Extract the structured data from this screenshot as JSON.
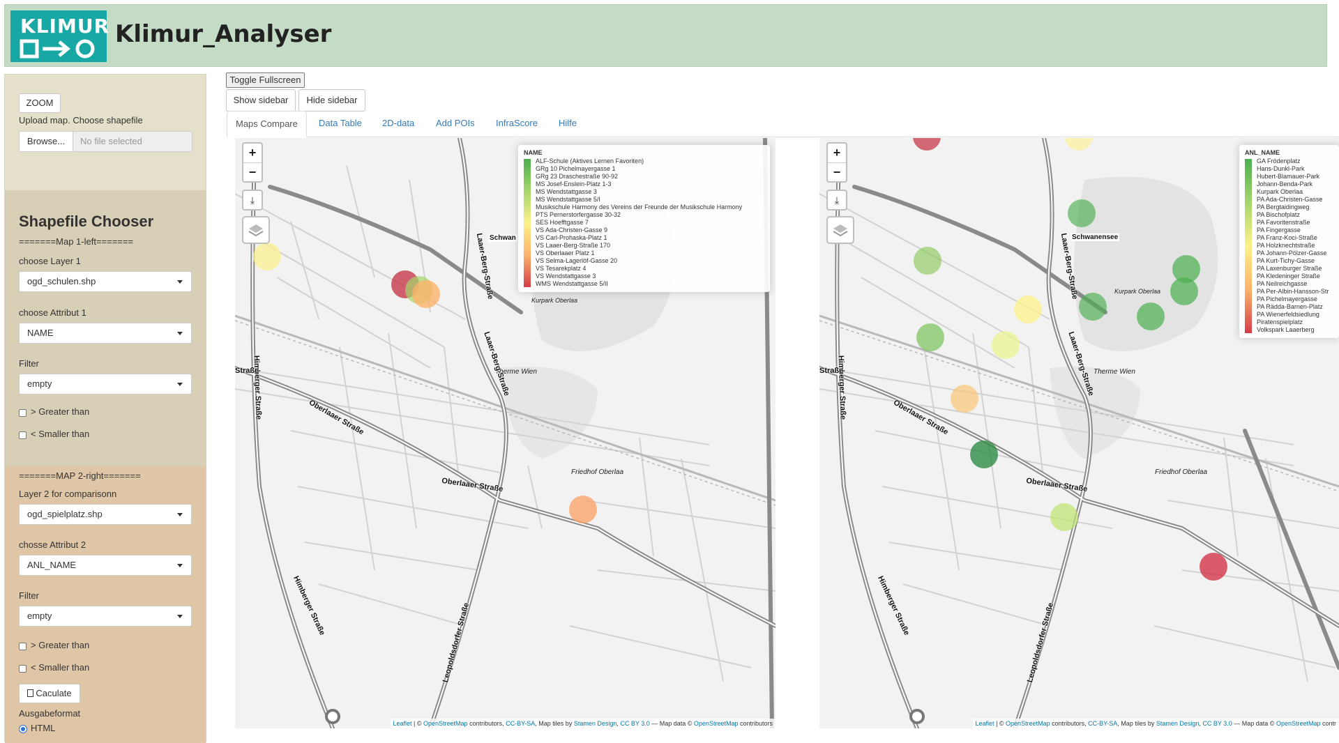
{
  "header": {
    "logo_text": "KLIMUR",
    "title": "Klimur_Analyser"
  },
  "sidebar": {
    "zoom_label": "ZOOM",
    "upload_label": "Upload map. Choose shapefile",
    "browse_label": "Browse...",
    "file_placeholder": "No file selected",
    "chooser_title": "Shapefile Chooser",
    "map1_heading": "=======Map 1-left=======",
    "layer1_label": "choose Layer 1",
    "layer1_value": "ogd_schulen.shp",
    "attr1_label": "choose Attribut 1",
    "attr1_value": "NAME",
    "filter1_label": "Filter",
    "filter1_value": "empty",
    "greater1_label": "> Greater than",
    "smaller1_label": "< Smaller than",
    "map2_heading": "=======MAP 2-right=======",
    "layer2_label": "Layer 2 for comparisonn",
    "layer2_value": "ogd_spielplatz.shp",
    "attr2_label": "chosse Attribut 2",
    "attr2_value": "ANL_NAME",
    "filter2_label": "Filter",
    "filter2_value": "empty",
    "greater2_label": "> Greater than",
    "smaller2_label": "< Smaller than",
    "calculate_label": "Caculate",
    "output_label": "Ausgabeformat",
    "output_option": "HTML"
  },
  "toolbar": {
    "fullscreen_label": "Toggle Fullscreen",
    "show_sidebar_label": "Show sidebar",
    "hide_sidebar_label": "Hide sidebar"
  },
  "tabs": [
    "Maps Compare",
    "Data Table",
    "2D-data",
    "Add POIs",
    "InfraScore",
    "Hilfe"
  ],
  "active_tab": "Maps Compare",
  "map_controls": {
    "zoom_in": "+",
    "zoom_out": "−"
  },
  "map_labels": {
    "schwanensee": "Schwanensee",
    "schwan_partial": "Schwan",
    "kurpark": "Kurpark Oberlaa",
    "therme": "Therme Wien",
    "friedhof": "Friedhof Oberlaa",
    "laaer_berg": "Laaer-Berg-Straße",
    "himberger": "Himberger Straße",
    "oberlaaer": "Oberlaaer Straße",
    "leopoldsdorfer": "Leopoldsdorfer Straße",
    "strasse": "Straße"
  },
  "legend_left": {
    "title": "NAME",
    "items": [
      "ALF-Schule (Aktives Lernen Favoriten)",
      "GRg 10 Pichelmayergasse 1",
      "GRg 23 Draschestraße 90-92",
      "MS Josef-Enslein-Platz 1-3",
      "MS Wendstattgasse 3",
      "MS Wendstattgasse 5/I",
      "Musikschule Harmony des Vereins der Freunde der Musikschule Harmony",
      "PTS Pernerstorfergasse 30-32",
      "SES Hoefftgasse 7",
      "VS Ada-Christen-Gasse 9",
      "VS Carl-Prohaska-Platz 1",
      "VS Laaer-Berg-Straße 170",
      "VS Oberlaaer Platz 1",
      "VS Selma-Lagerlöf-Gasse 20",
      "VS Tesarekplatz 4",
      "VS Wendstattgasse 3",
      "WMS Wendstattgasse 5/II"
    ]
  },
  "legend_right": {
    "title": "ANL_NAME",
    "items": [
      "GA Frödenplatz",
      "Hans-Dunkl-Park",
      "Hubert-Blamauer-Park",
      "Johann-Benda-Park",
      "Kurpark Oberlaa",
      "PA Ada-Christen-Gasse",
      "PA Bergtaidingweg",
      "PA Bischofplatz",
      "PA Favoritenstraße",
      "PA Fingergasse",
      "PA Franz-Koci-Straße",
      "PA Holzknechtstraße",
      "PA Johann-Pölzer-Gasse",
      "PA Kurt-Tichy-Gasse",
      "PA Laxenburger Straße",
      "PA Kledeninger Straße",
      "PA Neilreichgasse",
      "PA Per-Albin-Hansson-Str",
      "PA Pichelmayergasse",
      "PA Rädda-Barnen-Platz",
      "PA Wienerfeldsiedlung",
      "Piratenspielplatz",
      "Volkspark Laaerberg"
    ]
  },
  "attribution": {
    "leaflet": "Leaflet",
    "sep1": " | © ",
    "osm": "OpenStreetMap",
    "contrib": " contributors, ",
    "ccbysa": "CC-BY-SA",
    "tiles": ", Map tiles by ",
    "stamen": "Stamen Design",
    "comma": ", ",
    "ccby": "CC BY 3.0",
    "mapdata": " — Map data © ",
    "osm2": "OpenStreetMap",
    "contrib2_left": " contributors",
    "contrib2_right": " contr"
  },
  "colors": {
    "header_bg": "#c4dcc6",
    "logo_bg": "#17a7a4",
    "sidebar_top": "#e5e0c9",
    "sidebar_mid": "#d8cfb7",
    "sidebar_bot": "#dfc6a6",
    "link": "#337ab7",
    "legend_gradient": [
      "#4caf50",
      "#a5d66b",
      "#fef18a",
      "#fbb36a",
      "#d43c4a"
    ]
  }
}
